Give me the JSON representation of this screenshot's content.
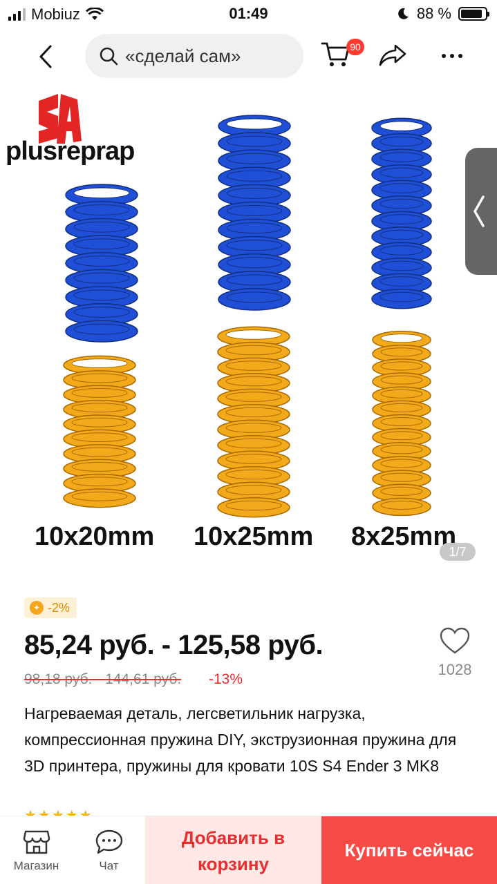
{
  "status": {
    "carrier": "Mobiuz",
    "time": "01:49",
    "battery": "88 %"
  },
  "nav": {
    "search_text": "«сделай сам»",
    "cart_badge": "90"
  },
  "gallery": {
    "brand": "plusreprap",
    "sizes": [
      "10x20mm",
      "10x25mm",
      "8x25mm"
    ],
    "page": "1/7"
  },
  "product": {
    "promo_badge": "-2%",
    "price": "85,24 руб. - 125,58 руб.",
    "old_price": "98,18 руб. - 144,61 руб.",
    "discount": "-13%",
    "wishlist_count": "1028",
    "title": "Нагреваемая деталь, легсветильник нагрузка, компрессионная пружина DIY, экструзионная пружина для 3D принтера, пружины для кровати 10S S4 Ender 3 MK8"
  },
  "colors": {
    "accent_red": "#f54a45",
    "spring_blue": "#1f4fd6",
    "spring_yellow": "#f2a91a"
  },
  "bottom": {
    "store_label": "Магазин",
    "chat_label": "Чат",
    "add_to_cart": "Добавить в корзину",
    "buy_now": "Купить сейчас"
  }
}
